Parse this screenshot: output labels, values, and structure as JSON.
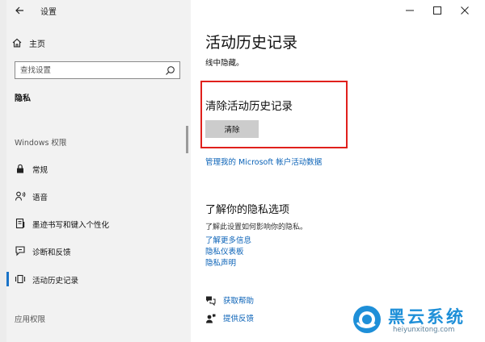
{
  "window": {
    "title": "设置"
  },
  "sidebar": {
    "home_label": "主页",
    "search_placeholder": "查找设置",
    "section_privacy": "隐私",
    "section_windows": "Windows 权限",
    "items": [
      {
        "label": "常规",
        "icon": "lock-icon"
      },
      {
        "label": "语音",
        "icon": "person-speech-icon"
      },
      {
        "label": "墨迹书写和键入个性化",
        "icon": "notebook-pen-icon"
      },
      {
        "label": "诊断和反馈",
        "icon": "feedback-icon"
      },
      {
        "label": "活动历史记录",
        "icon": "activity-history-icon",
        "active": true
      }
    ],
    "section_apps": "应用权限"
  },
  "main": {
    "title": "活动历史记录",
    "subline": "线中隐藏。",
    "clear_section": {
      "heading": "清除活动历史记录",
      "button_label": "清除"
    },
    "manage_link": "管理我的 Microsoft 帐户活动数据",
    "privacy": {
      "heading": "了解你的隐私选项",
      "description": "了解此设置如何影响你的隐私。",
      "links": [
        "了解更多信息",
        "隐私仪表板",
        "隐私声明"
      ]
    },
    "help": [
      {
        "label": "获取帮助",
        "icon": "help-chat-icon"
      },
      {
        "label": "提供反馈",
        "icon": "feedback-person-icon"
      }
    ]
  },
  "watermark": {
    "name": "黑云系统",
    "url": "heiyunxitong.com"
  },
  "colors": {
    "accent": "#1a73c8",
    "link": "#0a62b7",
    "highlight_border": "#e0201c",
    "sidebar_bg": "#f2f2f2"
  }
}
